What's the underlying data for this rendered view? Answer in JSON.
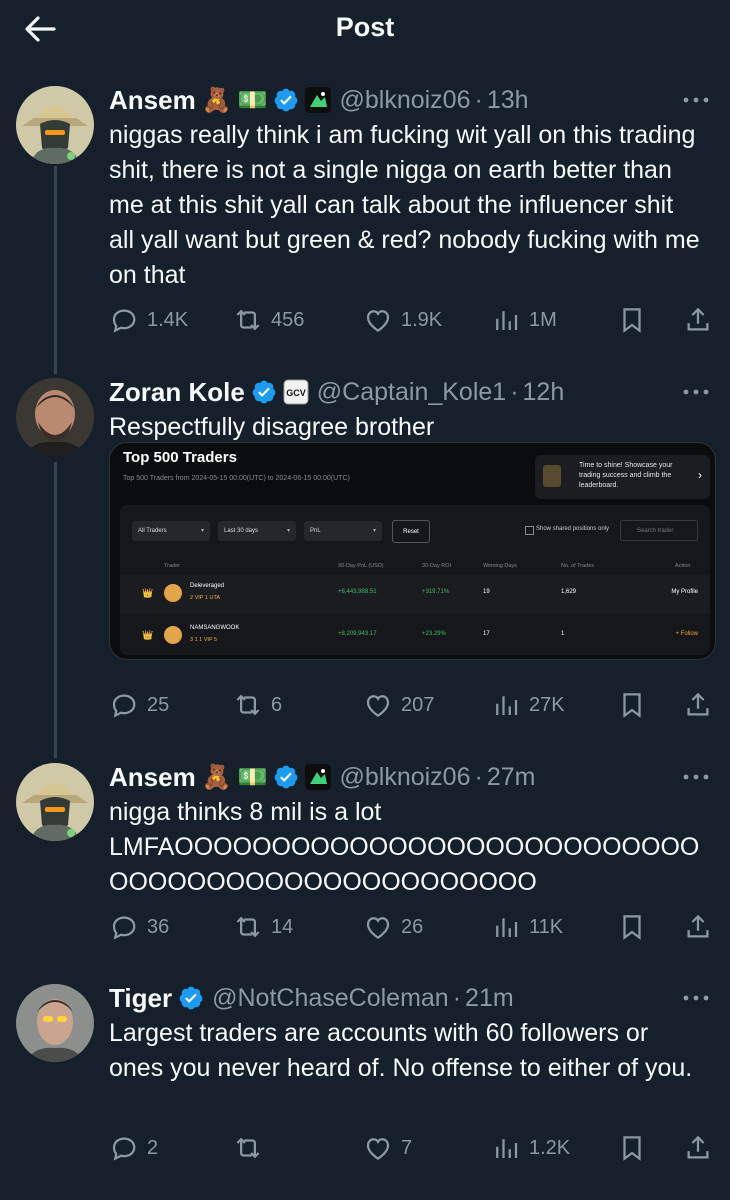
{
  "header": {
    "title": "Post"
  },
  "tweets": [
    {
      "name": "Ansem",
      "emoji": [
        "🧸",
        "💵"
      ],
      "handle": "@blknoiz06",
      "time": "13h",
      "text": "niggas really think i am fucking wit yall on this trading shit, there is not a single nigga on earth better than me at this shit yall can talk about the influencer shit all yall want but green & red? nobody fucking with me on that",
      "stats": {
        "replies": "1.4K",
        "retweets": "456",
        "likes": "1.9K",
        "views": "1M"
      }
    },
    {
      "name": "Zoran Kole",
      "affiliate": "GCV",
      "handle": "@Captain_Kole1",
      "time": "12h",
      "text": "Respectfully disagree brother",
      "stats": {
        "replies": "25",
        "retweets": "6",
        "likes": "207",
        "views": "27K"
      }
    },
    {
      "name": "Ansem",
      "emoji": [
        "🧸",
        "💵"
      ],
      "handle": "@blknoiz06",
      "time": "27m",
      "line1": "nigga thinks 8 mil is a lot",
      "line2": "LMFAOOOOOOOOOOOOOOOOOOOOOOOOOOO",
      "line3": "OOOOOOOOOOOOOOOOOOOOOO",
      "stats": {
        "replies": "36",
        "retweets": "14",
        "likes": "26",
        "views": "11K"
      }
    },
    {
      "name": "Tiger",
      "handle": "@NotChaseColeman",
      "time": "21m",
      "text": "Largest traders are accounts with 60 followers or ones you never heard of. No offense to either of you.",
      "stats": {
        "replies": "2",
        "retweets": "",
        "likes": "7",
        "views": "1.2K"
      }
    }
  ],
  "media": {
    "title": "Top 500 Traders",
    "subtitle": "Top 500 Traders from 2024-05-15 00:00(UTC) to 2024-06-15 00:00(UTC)",
    "promo": "Time to shine! Showcase your trading success and climb the leaderboard.",
    "filters": {
      "traders": "All Traders",
      "period": "Last 30 days",
      "sort": "PnL",
      "reset": "Reset",
      "show_shared": "Show shared positions only",
      "search_placeholder": "Search trader"
    },
    "columns": {
      "trader": "Trader",
      "pnl": "30-Day PnL (USD)",
      "roi": "30-Day ROI",
      "winning": "Winning Days",
      "trades": "No. of Trades",
      "action": "Action"
    },
    "rows": [
      {
        "name": "Deleveraged",
        "sub": "2 VIP 1 UTA",
        "pnl": "+8,443,988.51",
        "roi": "+319.71%",
        "days": "19",
        "trades": "1,629",
        "action": "My Profile"
      },
      {
        "name": "NAMSANGWOOK",
        "sub": "3 1 1 VIP 5",
        "pnl": "+8,209,943.17",
        "roi": "+23.29%",
        "days": "17",
        "trades": "1",
        "action": "+ Follow"
      }
    ]
  },
  "colors": {
    "background": "#15202b",
    "text": "#f7f9f9",
    "muted": "#8b98a5",
    "verified": "#1d9bf0",
    "line": "#38444d"
  },
  "icons": [
    "back-arrow-icon",
    "verified-badge-icon",
    "more-icon",
    "reply-icon",
    "retweet-icon",
    "like-icon",
    "views-icon",
    "bookmark-icon",
    "share-icon"
  ]
}
